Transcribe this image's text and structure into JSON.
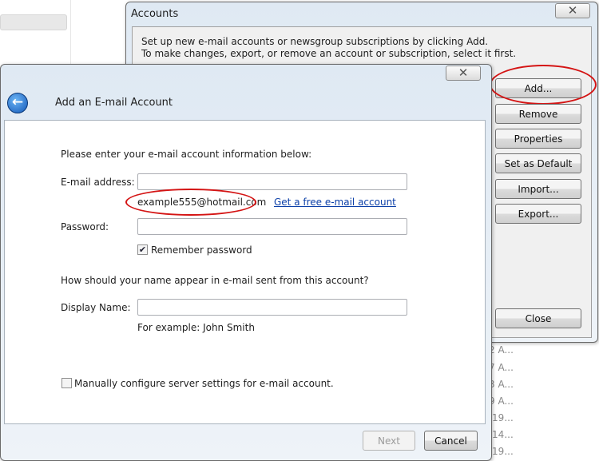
{
  "background": {
    "list_items": [
      "2 A...",
      "7 A...",
      "3 A...",
      "9 A...",
      ":19...",
      ":14...",
      ":19..."
    ]
  },
  "accounts": {
    "title": "Accounts",
    "close_glyph": "✕",
    "description": [
      "Set up new e-mail accounts or newsgroup subscriptions by clicking Add.",
      "To make changes, export, or remove an account or subscription, select it first."
    ],
    "buttons": {
      "add": "Add...",
      "remove": "Remove",
      "properties": "Properties",
      "set_default": "Set as Default",
      "import": "Import...",
      "export": "Export...",
      "close": "Close"
    }
  },
  "add_account": {
    "title": "Add an E-mail Account",
    "close_glyph": "✕",
    "back_icon": "back-arrow-icon",
    "intro": "Please enter your e-mail account information below:",
    "email_label": "E-mail address:",
    "email_value": "",
    "email_example": "example555@hotmail.com",
    "free_account_link": "Get a free e-mail account",
    "password_label": "Password:",
    "password_value": "",
    "remember_password": "Remember password",
    "remember_checked": true,
    "name_question": "How should your name appear in e-mail sent from this account?",
    "display_name_label": "Display Name:",
    "display_name_value": "",
    "display_name_example": "For example: John Smith",
    "manual_config": "Manually configure server settings for e-mail account.",
    "manual_checked": false,
    "next": "Next",
    "cancel": "Cancel"
  },
  "colors": {
    "annotation": "#d41414",
    "link": "#0b3fa8"
  }
}
